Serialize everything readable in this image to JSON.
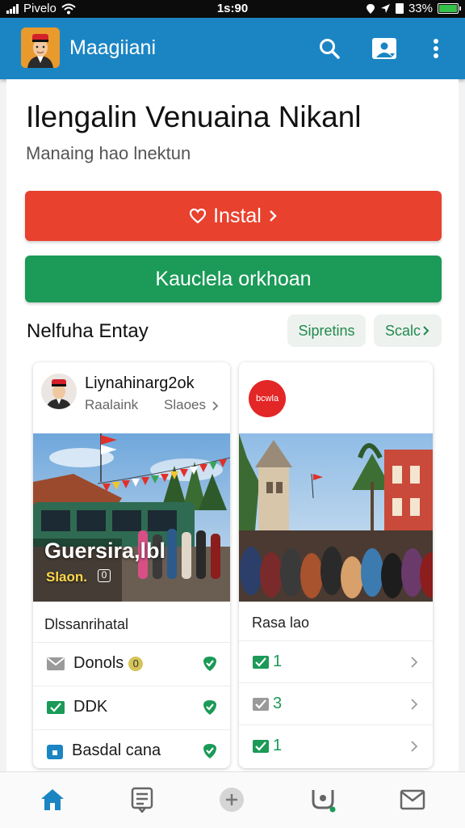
{
  "status": {
    "carrier": "Pivelo",
    "time": "1s:90",
    "battery": "33%"
  },
  "header": {
    "title": "Maagiiani",
    "icons": [
      "search-icon",
      "image-icon",
      "more-vert-icon"
    ]
  },
  "hero": {
    "title": "Ilengalin Venuaina Nikanl",
    "subtitle": "Manaing hao lnektun"
  },
  "actions": {
    "primary_label": "Instal",
    "secondary_label": "Kauclela orkhoan"
  },
  "section": {
    "title": "Nelfuha Entay",
    "chip1": "Sipretins",
    "chip2": "Scalc"
  },
  "card1": {
    "user": "Liynahinarg2ok",
    "meta1": "Raalaink",
    "meta2": "Slaoes",
    "overlay_title": "Guersira,lbl",
    "overlay_sub": "Slaon.",
    "overlay_badge": "0",
    "caption": "Dlssanrihatal",
    "rows": [
      {
        "label": "Donols",
        "badge": "0"
      },
      {
        "label": "DDK"
      },
      {
        "label": "Basdal cana"
      }
    ]
  },
  "card2": {
    "badge_text": "bcwla",
    "caption": "Rasa lao",
    "rows": [
      {
        "value": "1"
      },
      {
        "value": "3"
      },
      {
        "value": "1"
      }
    ]
  },
  "colors": {
    "app_bar": "#1b85c3",
    "primary_red": "#e8412e",
    "primary_green": "#1b9a58",
    "accent_green": "#1f8a4d",
    "nav_active": "#1b85c3"
  },
  "bottom_nav": [
    "home-icon",
    "list-icon",
    "add-icon",
    "people-icon",
    "mail-icon"
  ]
}
